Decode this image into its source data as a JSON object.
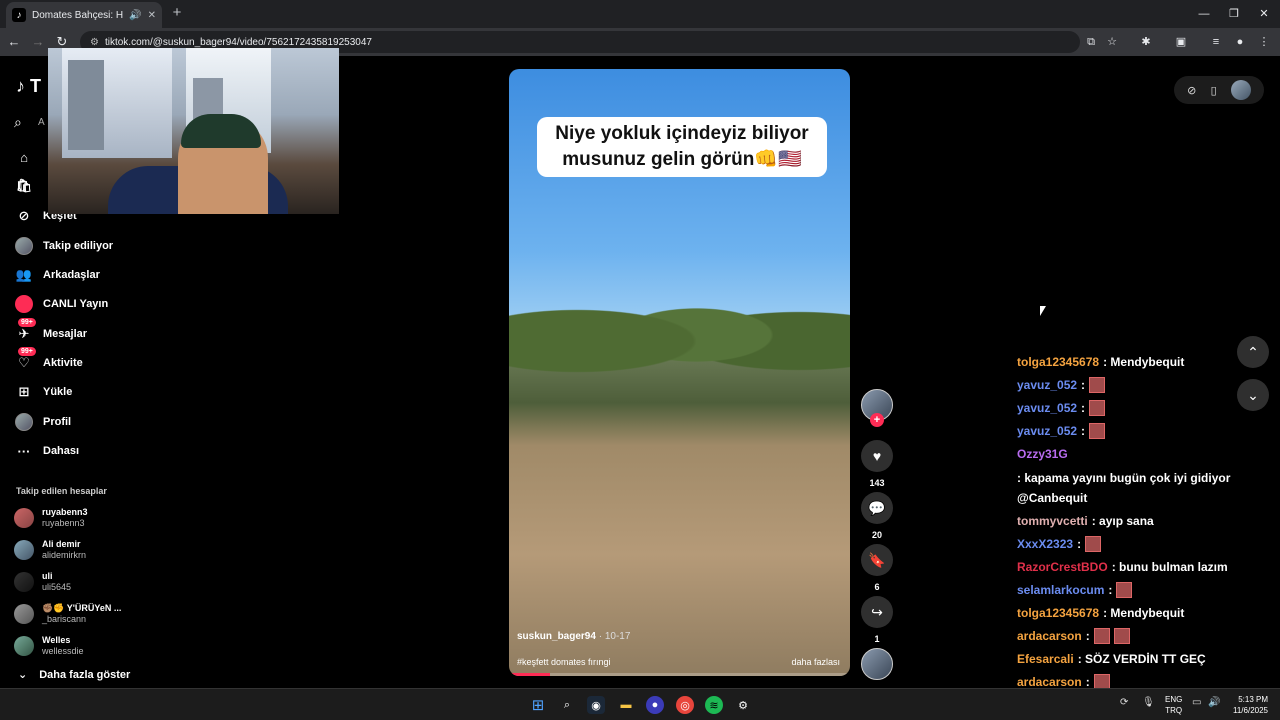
{
  "browser": {
    "tab_title": "Domates Bahçesi: Helal mi",
    "url": "tiktok.com/@suskun_bager94/video/7562172435819253047"
  },
  "sidebar": {
    "logo": "T",
    "search_placeholder": "A",
    "nav": [
      {
        "label": "",
        "icon": "home-icon"
      },
      {
        "label": "",
        "icon": "shop-icon"
      },
      {
        "label": "Keşfet",
        "icon": "compass-icon"
      },
      {
        "label": "Takip ediliyor",
        "icon": "following-avatar"
      },
      {
        "label": "Arkadaşlar",
        "icon": "friends-icon"
      },
      {
        "label": "CANLI Yayın",
        "icon": "live-icon"
      },
      {
        "label": "Mesajlar",
        "icon": "messages-icon",
        "badge": "99+"
      },
      {
        "label": "Aktivite",
        "icon": "activity-icon",
        "badge": "99+"
      },
      {
        "label": "Yükle",
        "icon": "upload-icon"
      },
      {
        "label": "Profil",
        "icon": "profile-avatar"
      },
      {
        "label": "Dahası",
        "icon": "more-icon"
      }
    ],
    "following_title": "Takip edilen hesaplar",
    "following": [
      {
        "name": "ruyabenn3",
        "user": "ruyabenn3"
      },
      {
        "name": "Ali demir",
        "user": "alidemirkrn"
      },
      {
        "name": "uli",
        "user": "uli5645"
      },
      {
        "name": "✊🏽✊ Y'ÜRÜYeN ...",
        "user": "_bariscann"
      },
      {
        "name": "Welles",
        "user": "wellessdie"
      }
    ],
    "show_more": "Daha fazla göster"
  },
  "video": {
    "caption": "Niye yokluk içindeyiz biliyor musunuz gelin görün👊🇺🇸",
    "author": "suskun_bager94",
    "date": "· 10-17",
    "tags": "#keşfett domates fırıngi",
    "more": "daha fazlası",
    "progress": 0.12
  },
  "actions": {
    "likes": "143",
    "comments": "20",
    "saves": "6",
    "shares": "1"
  },
  "chat": [
    {
      "user": "tolga12345678",
      "color": "#f4a340",
      "text": ": Mendybequit",
      "emotes": 0
    },
    {
      "user": "yavuz_052",
      "color": "#6b8cf0",
      "text": ":",
      "emotes": 1
    },
    {
      "user": "yavuz_052",
      "color": "#6b8cf0",
      "text": ":",
      "emotes": 1
    },
    {
      "user": "yavuz_052",
      "color": "#6b8cf0",
      "text": ":",
      "emotes": 1
    },
    {
      "user": "Ozzy31G",
      "color": "#b86cf0",
      "text": ": kapama yayını bugün çok iyi gidiyor @Canbequit",
      "emotes": 0
    },
    {
      "user": "tommyvcetti",
      "color": "#e0b0b0",
      "text": ": ayıp sana",
      "emotes": 0
    },
    {
      "user": "XxxX2323",
      "color": "#6b8cf0",
      "text": ":",
      "emotes": 1
    },
    {
      "user": "RazorCrestBDO",
      "color": "#e0304a",
      "text": ": bunu bulman lazım",
      "emotes": 0
    },
    {
      "user": "selamlarkocum",
      "color": "#6b8cf0",
      "text": ":",
      "emotes": 1
    },
    {
      "user": "tolga12345678",
      "color": "#f4a340",
      "text": ": Mendybequit",
      "emotes": 0
    },
    {
      "user": "ardacarson",
      "color": "#f4a340",
      "text": ":",
      "emotes": 2
    },
    {
      "user": "Efesarcali",
      "color": "#f4a340",
      "text": ": SÖZ VERDİN TT GEÇ",
      "emotes": 0
    },
    {
      "user": "ardacarson",
      "color": "#f4a340",
      "text": ":",
      "emotes": 1
    },
    {
      "user": "ardacarson",
      "color": "#f4a340",
      "text": ":",
      "emotes": 1
    },
    {
      "user": "ardacarson",
      "color": "#f4a340",
      "text": ":",
      "emotes": 1
    }
  ],
  "taskbar": {
    "lang_top": "ENG",
    "lang_bottom": "TRQ",
    "time": "5:13 PM",
    "date": "11/6/2025"
  },
  "colors": {
    "accent": "#fe2c55",
    "bg": "#000000"
  }
}
